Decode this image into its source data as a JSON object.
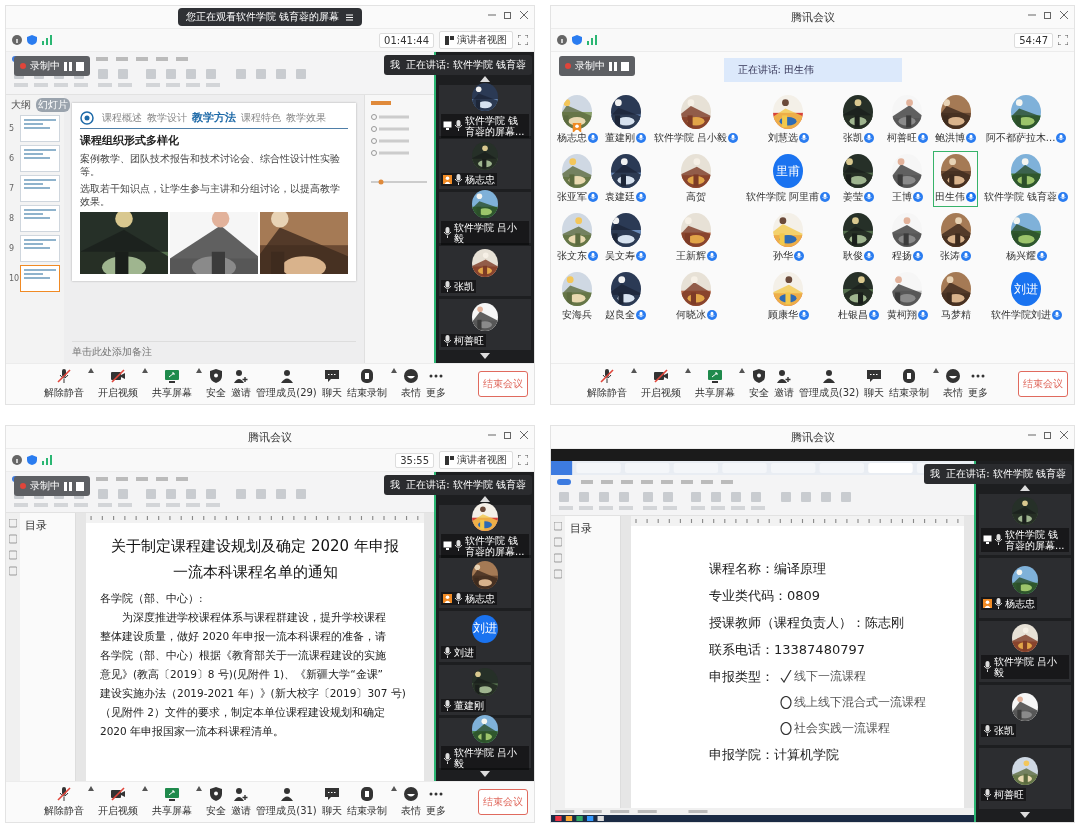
{
  "windows": [
    {
      "banner": "您正在观看软件学院 钱育蓉的屏幕",
      "timer": "01:41:44",
      "view_button": "演讲者视图",
      "recording": "录制中",
      "speaking": {
        "me": "我",
        "text": "正在讲话: 软件学院 钱育蓉"
      },
      "content": {
        "kind": "slides",
        "tabs": [
          {
            "label": "大纲",
            "selected": false
          },
          {
            "label": "幻灯片",
            "selected": true
          }
        ],
        "thumbnails": [
          {
            "number": "5",
            "selected": false
          },
          {
            "number": "6",
            "selected": false
          },
          {
            "number": "7",
            "selected": false
          },
          {
            "number": "8",
            "selected": false
          },
          {
            "number": "9",
            "selected": false
          },
          {
            "number": "10",
            "selected": true
          }
        ],
        "slide": {
          "nav": [
            {
              "label": "课程概述",
              "selected": false
            },
            {
              "label": "教学设计",
              "selected": false
            },
            {
              "label": "教学方法",
              "selected": true
            },
            {
              "label": "课程特色",
              "selected": false
            },
            {
              "label": "教学效果",
              "selected": false
            }
          ],
          "heading": "课程组织形式多样化",
          "paragraphs": [
            "案例教学、团队技术报告和技术讨论会、综合性设计性实验等。",
            "选取若干知识点，让学生参与主讲和分组讨论，以提高教学效果。"
          ],
          "photos": [
            {
              "kind": "picture"
            },
            {
              "kind": "picture"
            },
            {
              "kind": "picture"
            }
          ]
        },
        "notes_placeholder": "单击此处添加备注"
      },
      "strip": [
        {
          "name": "软件学院 钱育蓉的屏幕...",
          "sharing": true,
          "host": false,
          "avatar": {
            "kind": "picture"
          }
        },
        {
          "name": "杨志忠",
          "sharing": false,
          "host": true,
          "avatar": {
            "kind": "picture"
          }
        },
        {
          "name": "软件学院 吕小毅",
          "sharing": false,
          "host": false,
          "avatar": {
            "kind": "picture"
          }
        },
        {
          "name": "张凯",
          "sharing": false,
          "host": false,
          "avatar": {
            "kind": "picture"
          }
        },
        {
          "name": "柯善旺",
          "sharing": false,
          "host": false,
          "avatar": {
            "kind": "picture"
          }
        }
      ],
      "toolbar": [
        {
          "kind": "mic",
          "label": "解除静音",
          "off": true,
          "menu": true
        },
        {
          "kind": "video",
          "label": "开启视频",
          "off": true,
          "menu": true
        },
        {
          "kind": "share",
          "label": "共享屏幕",
          "menu": true
        },
        {
          "kind": "security",
          "label": "安全"
        },
        {
          "kind": "invite",
          "label": "邀请"
        },
        {
          "kind": "members",
          "label": "管理成员(29)"
        },
        {
          "kind": "chat",
          "label": "聊天"
        },
        {
          "kind": "record",
          "label": "结束录制",
          "menu": true
        },
        {
          "kind": "emoji",
          "label": "表情"
        },
        {
          "kind": "more",
          "label": "更多"
        }
      ],
      "end_button": "结束会议"
    },
    {
      "title": "腾讯会议",
      "timer": "54:47",
      "recording": "录制中",
      "content": {
        "kind": "gallery",
        "speaking_bar": "正在讲话: 田生伟",
        "participants": [
          {
            "name": "杨志忠",
            "mic": true,
            "speaking": false,
            "host": true,
            "avatar": {
              "kind": "picture"
            }
          },
          {
            "name": "董建刚",
            "mic": true,
            "speaking": false,
            "avatar": {
              "kind": "picture"
            }
          },
          {
            "name": "软件学院 吕小毅",
            "mic": true,
            "speaking": false,
            "avatar": {
              "kind": "picture"
            }
          },
          {
            "name": "刘慧选",
            "mic": true,
            "speaking": false,
            "avatar": {
              "kind": "picture"
            }
          },
          {
            "name": "张凯",
            "mic": true,
            "speaking": false,
            "avatar": {
              "kind": "picture"
            }
          },
          {
            "name": "柯善旺",
            "mic": true,
            "speaking": false,
            "avatar": {
              "kind": "picture"
            }
          },
          {
            "name": "鲍洪博",
            "mic": true,
            "speaking": false,
            "avatar": {
              "kind": "picture"
            }
          },
          {
            "name": "阿不都萨拉木...",
            "mic": true,
            "speaking": false,
            "avatar": {
              "kind": "picture"
            }
          },
          {
            "name": "张亚军",
            "mic": true,
            "speaking": false,
            "avatar": {
              "kind": "picture"
            }
          },
          {
            "name": "袁建廷",
            "mic": true,
            "speaking": false,
            "avatar": {
              "kind": "picture"
            }
          },
          {
            "name": "高贺",
            "mic": false,
            "speaking": false,
            "avatar": {
              "kind": "picture"
            }
          },
          {
            "name": "软件学院 阿里甫",
            "mic": true,
            "speaking": false,
            "avatar": {
              "kind": "initials",
              "text": "里甫"
            }
          },
          {
            "name": "姜莹",
            "mic": true,
            "speaking": false,
            "avatar": {
              "kind": "picture"
            }
          },
          {
            "name": "王博",
            "mic": true,
            "speaking": false,
            "avatar": {
              "kind": "picture"
            }
          },
          {
            "name": "田生伟",
            "mic": true,
            "speaking": true,
            "avatar": {
              "kind": "picture"
            }
          },
          {
            "name": "软件学院 钱育蓉",
            "mic": true,
            "speaking": false,
            "avatar": {
              "kind": "picture"
            }
          },
          {
            "name": "张文东",
            "mic": true,
            "speaking": false,
            "avatar": {
              "kind": "picture"
            }
          },
          {
            "name": "吴文寿",
            "mic": true,
            "speaking": false,
            "avatar": {
              "kind": "picture"
            }
          },
          {
            "name": "王新辉",
            "mic": true,
            "speaking": false,
            "avatar": {
              "kind": "picture"
            }
          },
          {
            "name": "孙华",
            "mic": true,
            "speaking": false,
            "avatar": {
              "kind": "picture"
            }
          },
          {
            "name": "耿俊",
            "mic": true,
            "speaking": false,
            "avatar": {
              "kind": "picture"
            }
          },
          {
            "name": "程扬",
            "mic": true,
            "speaking": false,
            "avatar": {
              "kind": "picture"
            }
          },
          {
            "name": "张涛",
            "mic": true,
            "speaking": false,
            "avatar": {
              "kind": "picture"
            }
          },
          {
            "name": "杨兴耀",
            "mic": true,
            "speaking": false,
            "avatar": {
              "kind": "picture"
            }
          },
          {
            "name": "安海兵",
            "mic": false,
            "speaking": false,
            "avatar": {
              "kind": "picture"
            }
          },
          {
            "name": "赵良全",
            "mic": true,
            "speaking": false,
            "avatar": {
              "kind": "picture"
            }
          },
          {
            "name": "何晓冰",
            "mic": true,
            "speaking": false,
            "avatar": {
              "kind": "picture"
            }
          },
          {
            "name": "顾康华",
            "mic": true,
            "speaking": false,
            "avatar": {
              "kind": "picture"
            }
          },
          {
            "name": "杜银昌",
            "mic": true,
            "speaking": false,
            "avatar": {
              "kind": "picture"
            }
          },
          {
            "name": "黄柯翔",
            "mic": true,
            "speaking": false,
            "avatar": {
              "kind": "picture"
            }
          },
          {
            "name": "马梦精",
            "mic": false,
            "speaking": false,
            "avatar": {
              "kind": "picture"
            }
          },
          {
            "name": "软件学院刘进",
            "mic": true,
            "speaking": false,
            "avatar": {
              "kind": "initials",
              "text": "刘进"
            }
          }
        ]
      },
      "toolbar": [
        {
          "kind": "mic",
          "label": "解除静音",
          "off": true,
          "menu": true
        },
        {
          "kind": "video",
          "label": "开启视频",
          "off": true,
          "menu": true
        },
        {
          "kind": "share",
          "label": "共享屏幕",
          "menu": true
        },
        {
          "kind": "security",
          "label": "安全"
        },
        {
          "kind": "invite",
          "label": "邀请"
        },
        {
          "kind": "members",
          "label": "管理成员(32)"
        },
        {
          "kind": "chat",
          "label": "聊天"
        },
        {
          "kind": "record",
          "label": "结束录制",
          "menu": true
        },
        {
          "kind": "emoji",
          "label": "表情"
        },
        {
          "kind": "more",
          "label": "更多"
        }
      ],
      "end_button": "结束会议"
    },
    {
      "title": "腾讯会议",
      "timer": "35:55",
      "view_button": "演讲者视图",
      "recording": "录制中",
      "speaking": {
        "me": "我",
        "text": "正在讲话: 软件学院 钱育蓉"
      },
      "content": {
        "kind": "document",
        "outline_title": "目录",
        "title_lines": [
          "关于制定课程建设规划及确定 2020 年申报",
          "一流本科课程名单的通知"
        ],
        "salutation": "各学院（部、中心）:",
        "body_lines": [
          "为深度推进学校课程体系与课程群建设，提升学校课程",
          "整体建设质量，做好 2020 年申报一流本科课程的准备，请",
          "各学院（部、中心）根据《教育部关于一流课程建设的实施",
          "意见》(教高〔2019〕8 号)(见附件 1)、《新疆大学“金课”",
          "建设实施办法（2019-2021 年）》(新大校字〔2019〕307 号)",
          "（见附件 2）文件的要求，制定本单位课程建设规划和确定",
          "2020 年申报国家一流本科课程清单。"
        ]
      },
      "strip": [
        {
          "name": "软件学院 钱育蓉的屏幕...",
          "sharing": true,
          "host": false,
          "avatar": {
            "kind": "picture"
          }
        },
        {
          "name": "杨志忠",
          "sharing": false,
          "host": true,
          "avatar": {
            "kind": "picture"
          }
        },
        {
          "name": "刘进",
          "sharing": false,
          "host": false,
          "avatar": {
            "kind": "initials",
            "text": "刘进"
          }
        },
        {
          "name": "董建刚",
          "sharing": false,
          "host": false,
          "avatar": {
            "kind": "picture"
          }
        },
        {
          "name": "软件学院 吕小毅",
          "sharing": false,
          "host": false,
          "avatar": {
            "kind": "picture"
          }
        }
      ],
      "toolbar": [
        {
          "kind": "mic",
          "label": "解除静音",
          "off": true,
          "menu": true
        },
        {
          "kind": "video",
          "label": "开启视频",
          "off": true,
          "menu": true
        },
        {
          "kind": "share",
          "label": "共享屏幕",
          "menu": true
        },
        {
          "kind": "security",
          "label": "安全"
        },
        {
          "kind": "invite",
          "label": "邀请"
        },
        {
          "kind": "members",
          "label": "管理成员(31)"
        },
        {
          "kind": "chat",
          "label": "聊天"
        },
        {
          "kind": "record",
          "label": "结束录制",
          "menu": true
        },
        {
          "kind": "emoji",
          "label": "表情"
        },
        {
          "kind": "more",
          "label": "更多"
        }
      ],
      "end_button": "结束会议"
    },
    {
      "title": "腾讯会议",
      "speaking": {
        "me": "我",
        "text": "正在讲话: 软件学院 钱育蓉"
      },
      "content": {
        "kind": "form",
        "outline_title": "目录",
        "fields": [
          {
            "kind": "line",
            "text": "课程名称：编译原理"
          },
          {
            "kind": "line",
            "text": "专业类代码：0809"
          },
          {
            "kind": "line",
            "text": "授课教师（课程负责人）：陈志刚"
          },
          {
            "kind": "line",
            "text": "联系电话：13387480797"
          },
          {
            "kind": "choice",
            "label": "申报类型：",
            "options": [
              {
                "text": "线下一流课程",
                "checked": true
              },
              {
                "text": "线上线下混合式一流课程",
                "checked": false
              },
              {
                "text": "社会实践一流课程",
                "checked": false
              }
            ]
          },
          {
            "kind": "line",
            "text": "申报学院：计算机学院"
          }
        ]
      },
      "strip": [
        {
          "name": "软件学院 钱育蓉的屏幕...",
          "sharing": true,
          "host": false,
          "avatar": {
            "kind": "picture"
          }
        },
        {
          "name": "杨志忠",
          "sharing": false,
          "host": true,
          "avatar": {
            "kind": "picture"
          }
        },
        {
          "name": "软件学院 吕小毅",
          "sharing": false,
          "host": false,
          "avatar": {
            "kind": "picture"
          }
        },
        {
          "name": "张凯",
          "sharing": false,
          "host": false,
          "avatar": {
            "kind": "picture"
          }
        },
        {
          "name": "柯善旺",
          "sharing": false,
          "host": false,
          "avatar": {
            "kind": "picture"
          }
        }
      ]
    }
  ]
}
